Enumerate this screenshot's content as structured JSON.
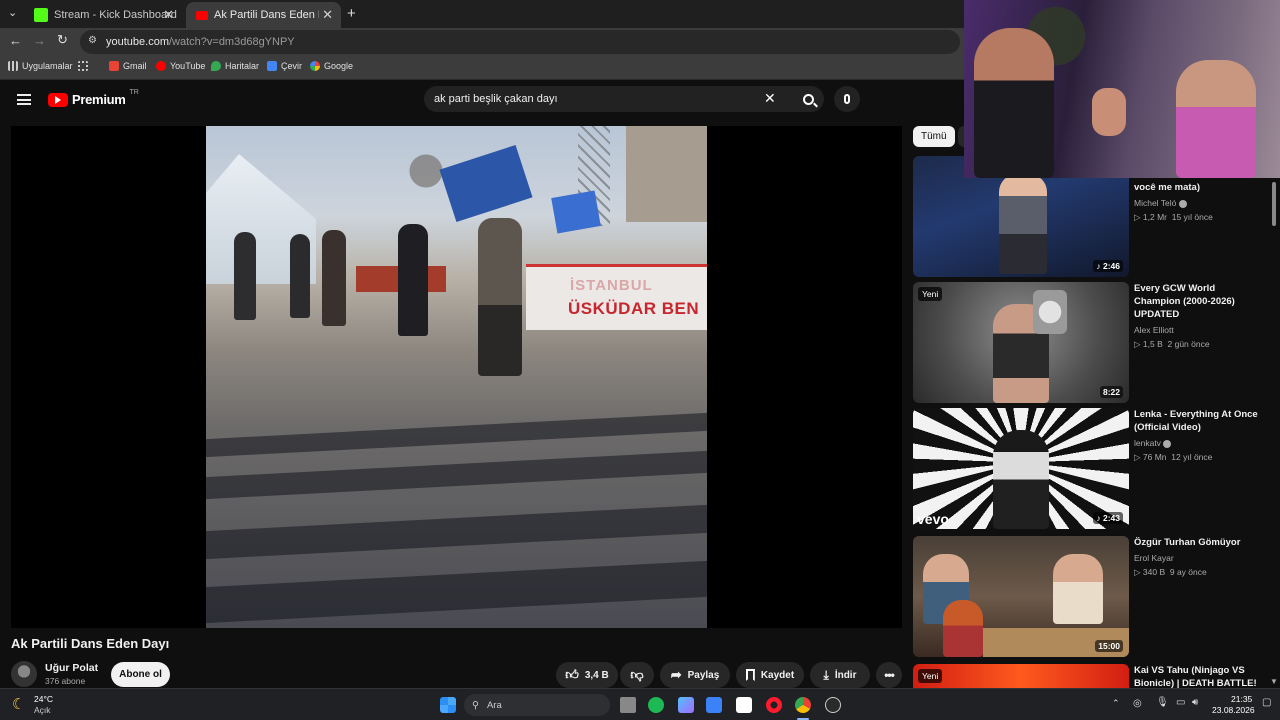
{
  "browser": {
    "tabs": [
      {
        "title": "Stream - Kick Dashboard",
        "active": false
      },
      {
        "title": "Ak Partili Dans Eden Dayı - YouTube",
        "active": true
      }
    ],
    "url_host": "youtube.com",
    "url_path": "/watch?v=dm3d68gYNPY",
    "bookmarks": [
      "Uygulamalar",
      "Gmail",
      "YouTube",
      "Haritalar",
      "Çevir",
      "Google"
    ]
  },
  "youtube": {
    "logo_text": "Premium",
    "logo_region": "TR",
    "search_query": "ak parti beşlik çakan dayı",
    "filter_chip": "Tümü"
  },
  "video": {
    "title": "Ak Partili Dans Eden Dayı",
    "channel": "Uğur Polat",
    "subscribers": "376 abone",
    "subscribe_label": "Abone ol",
    "likes": "3,4 B",
    "share_label": "Paylaş",
    "save_label": "Kaydet",
    "download_label": "İndir",
    "sign_text_1": "İSTANBUL",
    "sign_text_2": "ÜSKÜDAR BEN"
  },
  "recommendations": [
    {
      "title": "você me mata)",
      "channel": "Michel Teló",
      "verified": true,
      "views": "1,2 Mr",
      "age": "15 yıl önce",
      "duration": "2:46",
      "music": true,
      "new": false
    },
    {
      "title": "Every GCW World Champion (2000-2026) UPDATED",
      "channel": "Alex Elliott",
      "verified": false,
      "views": "1,5 B",
      "age": "2 gün önce",
      "duration": "8:22",
      "music": false,
      "new": true
    },
    {
      "title": "Lenka - Everything At Once (Official Video)",
      "channel": "lenkatv",
      "verified": true,
      "views": "76 Mn",
      "age": "12 yıl önce",
      "duration": "2:43",
      "music": true,
      "new": false,
      "watermark": "vevo"
    },
    {
      "title": "Özgür Turhan Gömüyor",
      "channel": "Erol Kayar",
      "verified": false,
      "views": "340 B",
      "age": "9 ay önce",
      "duration": "15:00",
      "music": false,
      "new": false
    },
    {
      "title": "Kai VS Tahu (Ninjago VS Bionicle) | DEATH BATTLE!",
      "new": true
    }
  ],
  "taskbar": {
    "weather_temp": "24°C",
    "weather_desc": "Açık",
    "search_placeholder": "Ara",
    "time": "21:35",
    "date": "23.08.2026"
  },
  "colors": {
    "yt_red": "#ff0000",
    "kick_green": "#53fc18",
    "bg": "#0f0f0f"
  }
}
